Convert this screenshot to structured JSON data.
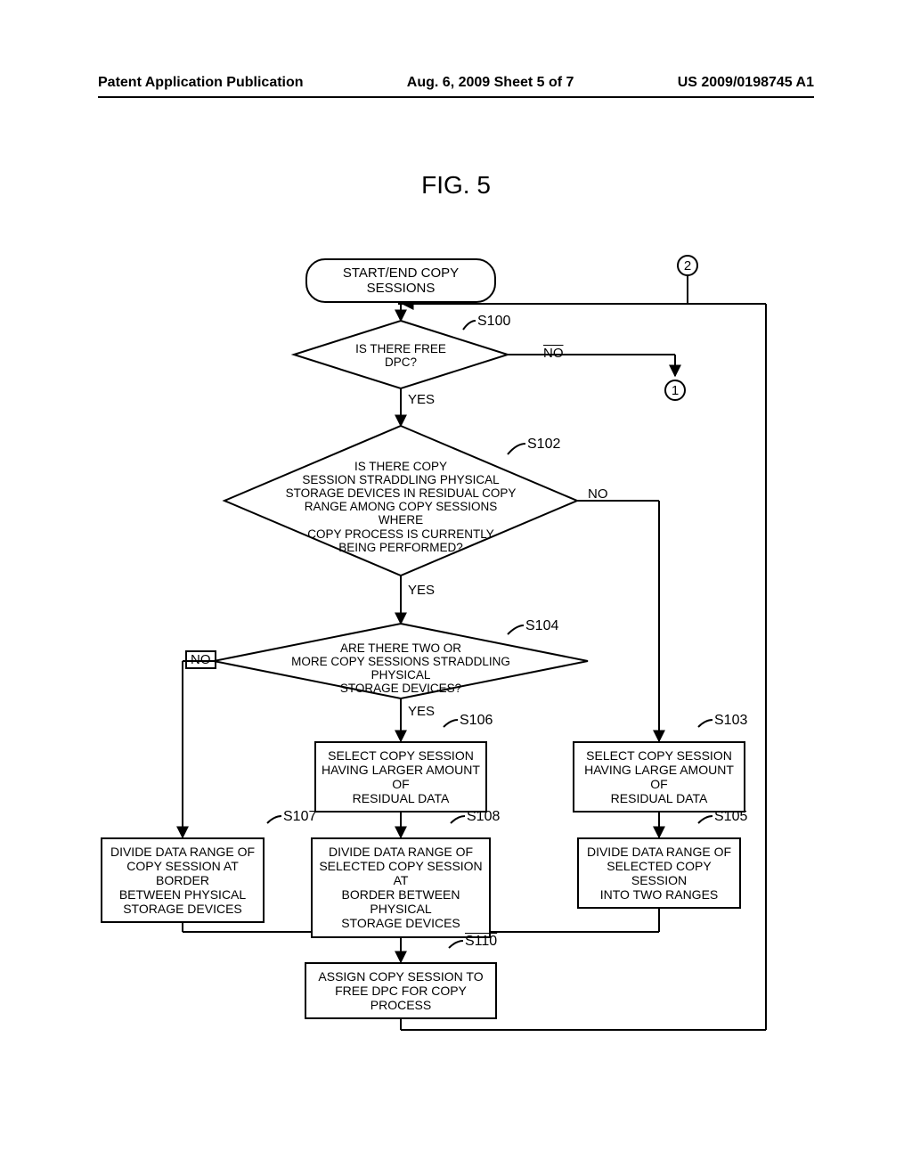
{
  "header": {
    "left": "Patent Application Publication",
    "center": "Aug. 6, 2009  Sheet 5 of 7",
    "right": "US 2009/0198745 A1"
  },
  "figure_title": "FIG. 5",
  "flow": {
    "start": "START/END COPY SESSIONS",
    "s100": {
      "label": "S100",
      "text": "IS THERE FREE\nDPC?",
      "yes": "YES",
      "no": "NO"
    },
    "s102": {
      "label": "S102",
      "text": "IS THERE COPY\nSESSION STRADDLING PHYSICAL\nSTORAGE DEVICES IN RESIDUAL COPY\nRANGE AMONG COPY SESSIONS WHERE\nCOPY PROCESS IS CURRENTLY\nBEING PERFORMED?",
      "yes": "YES",
      "no": "NO"
    },
    "s104": {
      "label": "S104",
      "text": "ARE THERE TWO OR\nMORE COPY SESSIONS STRADDLING PHYSICAL\nSTORAGE DEVICES?",
      "yes": "YES",
      "no": "NO"
    },
    "s103": {
      "label": "S103",
      "text": "SELECT COPY SESSION\nHAVING LARGE AMOUNT OF\nRESIDUAL DATA"
    },
    "s106": {
      "label": "S106",
      "text": "SELECT COPY SESSION\nHAVING LARGER AMOUNT OF\nRESIDUAL DATA"
    },
    "s105": {
      "label": "S105",
      "text": "DIVIDE DATA RANGE OF\nSELECTED COPY SESSION\nINTO TWO RANGES"
    },
    "s107": {
      "label": "S107",
      "text": "DIVIDE DATA RANGE OF\nCOPY SESSION AT BORDER\nBETWEEN PHYSICAL\nSTORAGE DEVICES"
    },
    "s108": {
      "label": "S108",
      "text": "DIVIDE DATA RANGE OF\nSELECTED COPY SESSION AT\nBORDER BETWEEN PHYSICAL\nSTORAGE DEVICES"
    },
    "s110": {
      "label": "S110",
      "text": "ASSIGN COPY SESSION TO\nFREE DPC FOR COPY PROCESS"
    },
    "connector_1": "1",
    "connector_2": "2"
  },
  "chart_data": {
    "type": "flowchart",
    "nodes": [
      {
        "id": "start",
        "shape": "terminator",
        "text": "START/END COPY SESSIONS"
      },
      {
        "id": "S100",
        "shape": "decision",
        "text": "IS THERE FREE DPC?"
      },
      {
        "id": "S102",
        "shape": "decision",
        "text": "IS THERE COPY SESSION STRADDLING PHYSICAL STORAGE DEVICES IN RESIDUAL COPY RANGE AMONG COPY SESSIONS WHERE COPY PROCESS IS CURRENTLY BEING PERFORMED?"
      },
      {
        "id": "S104",
        "shape": "decision",
        "text": "ARE THERE TWO OR MORE COPY SESSIONS STRADDLING PHYSICAL STORAGE DEVICES?"
      },
      {
        "id": "S103",
        "shape": "process",
        "text": "SELECT COPY SESSION HAVING LARGE AMOUNT OF RESIDUAL DATA"
      },
      {
        "id": "S106",
        "shape": "process",
        "text": "SELECT COPY SESSION HAVING LARGER AMOUNT OF RESIDUAL DATA"
      },
      {
        "id": "S105",
        "shape": "process",
        "text": "DIVIDE DATA RANGE OF SELECTED COPY SESSION INTO TWO RANGES"
      },
      {
        "id": "S107",
        "shape": "process",
        "text": "DIVIDE DATA RANGE OF COPY SESSION AT BORDER BETWEEN PHYSICAL STORAGE DEVICES"
      },
      {
        "id": "S108",
        "shape": "process",
        "text": "DIVIDE DATA RANGE OF SELECTED COPY SESSION AT BORDER BETWEEN PHYSICAL STORAGE DEVICES"
      },
      {
        "id": "S110",
        "shape": "process",
        "text": "ASSIGN COPY SESSION TO FREE DPC FOR COPY PROCESS"
      },
      {
        "id": "C1",
        "shape": "connector",
        "text": "1"
      },
      {
        "id": "C2",
        "shape": "connector",
        "text": "2"
      }
    ],
    "edges": [
      {
        "from": "start",
        "to": "S100"
      },
      {
        "from": "S100",
        "to": "S102",
        "label": "YES"
      },
      {
        "from": "S100",
        "to": "C1",
        "label": "NO"
      },
      {
        "from": "S102",
        "to": "S104",
        "label": "YES"
      },
      {
        "from": "S102",
        "to": "S103",
        "label": "NO"
      },
      {
        "from": "S104",
        "to": "S106",
        "label": "YES"
      },
      {
        "from": "S104",
        "to": "S107",
        "label": "NO"
      },
      {
        "from": "S106",
        "to": "S108"
      },
      {
        "from": "S103",
        "to": "S105"
      },
      {
        "from": "S107",
        "to": "S110"
      },
      {
        "from": "S108",
        "to": "S110"
      },
      {
        "from": "S105",
        "to": "S110"
      },
      {
        "from": "S110",
        "to": "S100",
        "note": "loop back"
      },
      {
        "from": "C2",
        "to": "S100",
        "note": "loop entry"
      }
    ]
  }
}
